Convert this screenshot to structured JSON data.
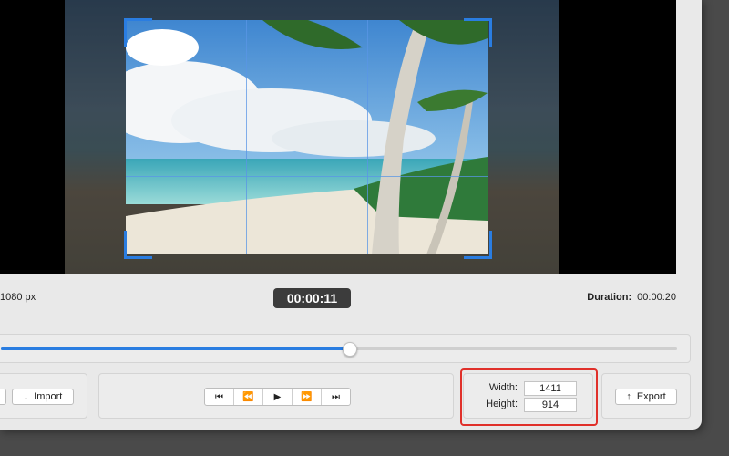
{
  "viewer": {
    "resolution_text": "1080 px",
    "timecode": "00:00:11",
    "duration_label": "Duration:",
    "duration_value": "00:00:20",
    "playback_fraction": 0.515
  },
  "left_panel": {
    "import_label": "Import",
    "import_icon": "arrow-down-icon"
  },
  "transport": {
    "buttons": [
      {
        "name": "skip-to-start",
        "glyph": "⏮"
      },
      {
        "name": "rewind",
        "glyph": "⏪"
      },
      {
        "name": "play",
        "glyph": "▶"
      },
      {
        "name": "fast-forward",
        "glyph": "⏩"
      },
      {
        "name": "skip-to-end",
        "glyph": "⏭"
      }
    ]
  },
  "size": {
    "width_label": "Width:",
    "width_value": "1411",
    "height_label": "Height:",
    "height_value": "914"
  },
  "export": {
    "label": "Export",
    "icon": "arrow-up-icon"
  },
  "colors": {
    "accent": "#2a7de1",
    "highlight": "#e0302a",
    "timecode_bg": "#3c3c3c"
  }
}
